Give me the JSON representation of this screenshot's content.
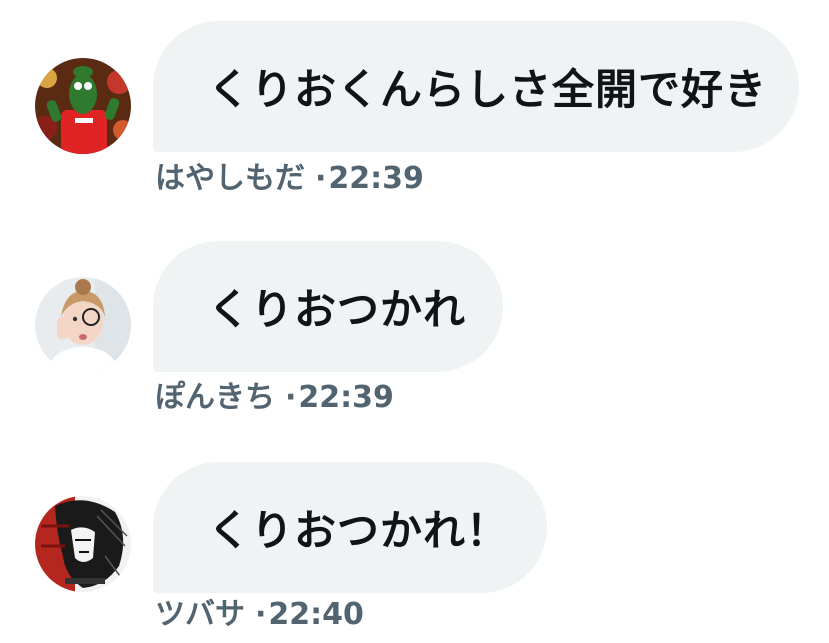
{
  "messages": [
    {
      "avatar_icon": "mascot-avatar-icon",
      "text": "くりおくんらしさ全開で好き",
      "author": "はやしもだ",
      "time": "22:39"
    },
    {
      "avatar_icon": "girl-photo-avatar-icon",
      "text": "くりおつかれ",
      "author": "ぽんきち",
      "time": "22:39"
    },
    {
      "avatar_icon": "sketch-portrait-avatar-icon",
      "text": "くりおつかれ！",
      "author": "ツバサ",
      "time": "22:40"
    }
  ],
  "separator": "·",
  "colors": {
    "bubble_bg": "#eff3f4",
    "text": "#0f1419",
    "meta": "#536471"
  }
}
